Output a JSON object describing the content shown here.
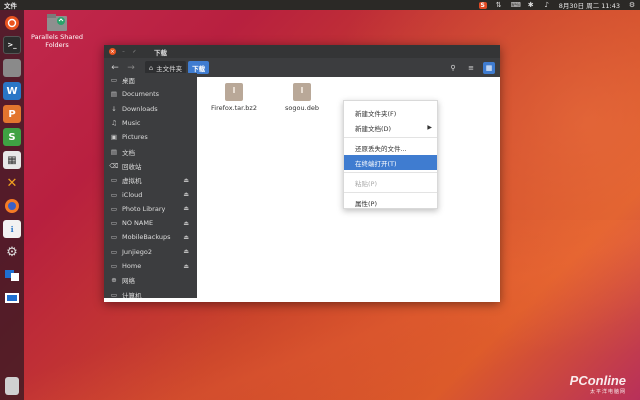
{
  "topbar": {
    "app_name": "文件",
    "datetime": "8月30日 周二 11:43",
    "icons": [
      "sogou-icon",
      "network-icon",
      "keyboard-icon",
      "bluetooth-icon",
      "volume-icon",
      "power-icon"
    ]
  },
  "desktop": {
    "shared_folder_label": "Parallels Shared Folders"
  },
  "launcher": {
    "items": [
      "dash-icon",
      "terminal-icon",
      "files-icon",
      "writer-icon",
      "impress-icon",
      "calc-icon",
      "software-icon",
      "xcode-x-icon",
      "firefox-icon",
      "software-center-icon",
      "settings-icon",
      "parallels-icon",
      "parallels-icon-2",
      "trash-icon"
    ]
  },
  "window": {
    "title": "下载",
    "breadcrumb": {
      "home": "主文件夹",
      "current": "下载"
    },
    "sidebar": [
      {
        "label": "桌面",
        "icon": "desktop-icon",
        "eject": false
      },
      {
        "label": "Documents",
        "icon": "documents-icon",
        "eject": false
      },
      {
        "label": "Downloads",
        "icon": "downloads-icon",
        "eject": false
      },
      {
        "label": "Music",
        "icon": "music-icon",
        "eject": false
      },
      {
        "label": "Pictures",
        "icon": "pictures-icon",
        "eject": false
      },
      {
        "label": "文档",
        "icon": "documents-icon",
        "eject": false
      },
      {
        "label": "回收站",
        "icon": "trash-icon",
        "eject": false
      },
      {
        "label": "虚拟机",
        "icon": "drive-icon",
        "eject": true
      },
      {
        "label": "iCloud",
        "icon": "drive-icon",
        "eject": true
      },
      {
        "label": "Photo Library",
        "icon": "drive-icon",
        "eject": true
      },
      {
        "label": "NO NAME",
        "icon": "drive-icon",
        "eject": true
      },
      {
        "label": "MobileBackups",
        "icon": "drive-icon",
        "eject": true
      },
      {
        "label": "Junjiego2",
        "icon": "drive-icon",
        "eject": true
      },
      {
        "label": "Home",
        "icon": "drive-icon",
        "eject": true
      },
      {
        "label": "网络",
        "icon": "network-icon",
        "eject": false
      },
      {
        "label": "计算机",
        "icon": "computer-icon",
        "eject": false
      }
    ],
    "files": [
      {
        "name": "Firefox.tar.bz2"
      },
      {
        "name": "sogou.deb"
      }
    ]
  },
  "context_menu": {
    "items": [
      {
        "label": "新建文件夹(F)",
        "state": "normal"
      },
      {
        "label": "新建文档(D)",
        "state": "submenu"
      },
      {
        "label": "还原丢失的文件...",
        "state": "normal"
      },
      {
        "label": "在终端打开(T)",
        "state": "highlighted"
      },
      {
        "label": "粘贴(P)",
        "state": "disabled"
      },
      {
        "label": "属性(P)",
        "state": "normal"
      }
    ]
  },
  "watermark": {
    "main": "PConline",
    "sub": "太平洋电脑网"
  },
  "colors": {
    "accent": "#3f7cd0",
    "ubuntu_orange": "#e95420",
    "sidebar_bg": "#3c3d3f"
  }
}
